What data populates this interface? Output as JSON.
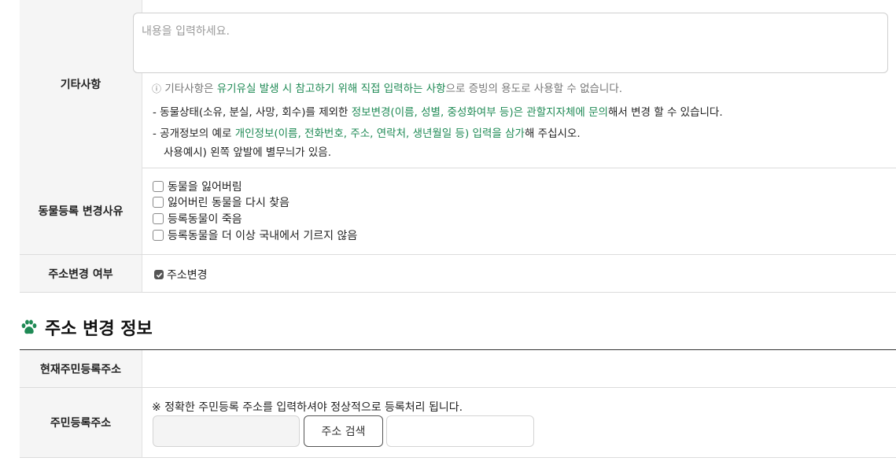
{
  "etc": {
    "label": "기타사항",
    "placeholder": "내용을 입력하세요.",
    "info_prefix": "기타사항은 ",
    "info_highlight": "유기유실 발생 시 참고하기 위해 직접 입력하는 사항",
    "info_suffix": "으로 증빙의 용도로 사용할 수 없습니다.",
    "note1_prefix": "- 동물상태(소유, 분실, 사망, 회수)를 제외한 ",
    "note1_highlight": "정보변경(이름, 성별, 중성화여부 등)은 관할지자체에 문의",
    "note1_suffix": "해서 변경 할 수 있습니다.",
    "note2_prefix": "- 공개정보의 예로 ",
    "note2_highlight": "개인정보(이름, 전화번호, 주소, 연락처, 생년월일 등) 입력을 삼가",
    "note2_suffix": "해 주십시오.",
    "note2_example": "사용예시) 왼쪽 앞발에 별무늬가 있음."
  },
  "change_reason": {
    "label": "동물등록 변경사유",
    "options": [
      "동물을 잃어버림",
      "잃어버린 동물을 다시 찾음",
      "등록동물이 죽음",
      "등록동물을 더 이상 국내에서 기르지 않음"
    ]
  },
  "address_change": {
    "label": "주소변경 여부",
    "checkbox_label": "주소변경",
    "checked": true
  },
  "section": {
    "title": "주소 변경 정보",
    "icon": "paw-icon",
    "icon_color": "#1f8a55"
  },
  "current_address": {
    "label": "현재주민등록주소"
  },
  "resident_address": {
    "label": "주민등록주소",
    "notice": "※ 정확한 주민등록 주소를 입력하셔야 정상적으로 등록처리 됩니다.",
    "search_button": "주소 검색"
  }
}
